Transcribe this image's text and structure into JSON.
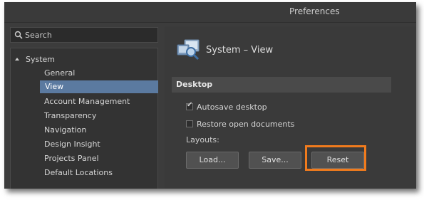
{
  "window": {
    "title": "Preferences"
  },
  "search": {
    "placeholder": "Search"
  },
  "tree": {
    "root": "System",
    "items": [
      "General",
      "View",
      "Account Management",
      "Transparency",
      "Navigation",
      "Design Insight",
      "Projects Panel",
      "Default Locations"
    ],
    "selected": "View"
  },
  "panel": {
    "title": "System – View",
    "section": "Desktop",
    "autosave_label": "Autosave desktop",
    "autosave_checked": true,
    "restore_label": "Restore open documents",
    "restore_checked": false,
    "layouts_label": "Layouts:",
    "load_label": "Load...",
    "save_label": "Save...",
    "reset_label": "Reset"
  },
  "colors": {
    "highlight": "#f07b1d",
    "selection": "#5b7aa0"
  }
}
